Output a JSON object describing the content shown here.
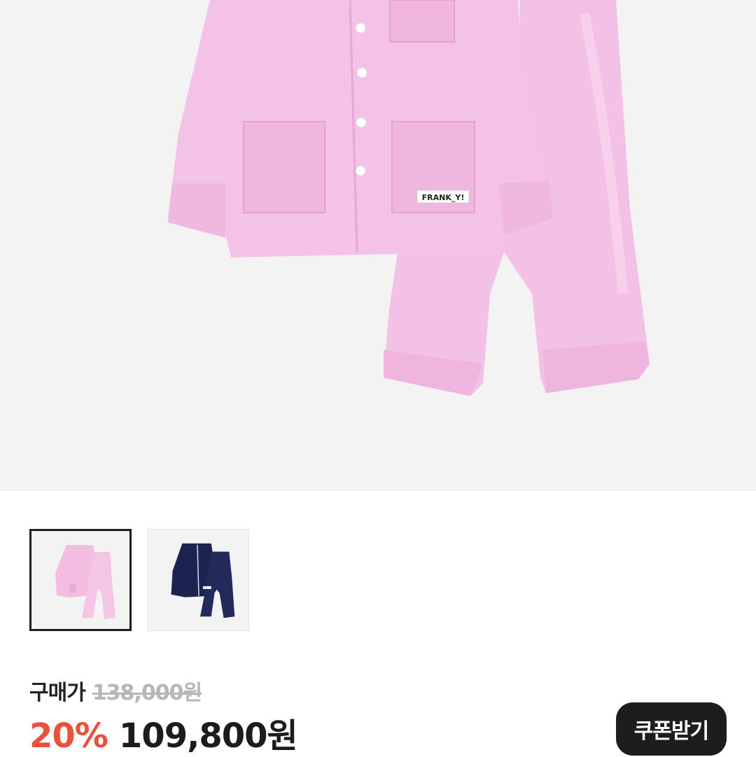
{
  "product": {
    "label_text": "FRANK_Y!",
    "image_alt": "pink satin pajama set"
  },
  "thumbnails": [
    {
      "name": "pink-pajama",
      "selected": true,
      "color": "#f2bde0"
    },
    {
      "name": "navy-pajama",
      "selected": false,
      "color": "#1d2350"
    }
  ],
  "price": {
    "label": "구매가",
    "original": "138,000원",
    "discount": "20%",
    "final": "109,800원"
  },
  "coupon": {
    "label": "쿠폰받기"
  },
  "colors": {
    "discount": "#e8513c",
    "button_bg": "#1d1d1d",
    "hero_bg": "#f3f3f3"
  }
}
